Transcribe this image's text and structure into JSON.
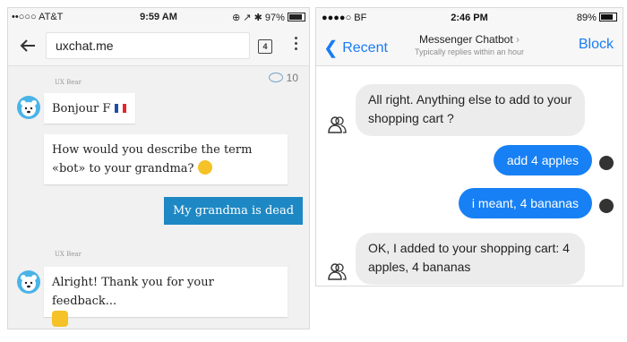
{
  "left_phone": {
    "status": {
      "carrier": "••○○○ AT&T",
      "time": "9:59 AM",
      "battery": "97%"
    },
    "url": "uxchat.me",
    "tab_count": "4",
    "viewer_count": "10",
    "messages": [
      {
        "sender": "UX Bear",
        "text": "Bonjour F"
      },
      {
        "text": "How would you describe the term «bot» to your grandma?"
      },
      {
        "text": "My grandma is dead"
      },
      {
        "sender": "UX Bear",
        "text": "Alright! Thank you for your feedback..."
      }
    ]
  },
  "right_phone": {
    "status": {
      "carrier": "●●●●○ BF",
      "time": "2:46 PM",
      "battery": "89%"
    },
    "nav": {
      "back": "Recent",
      "title": "Messenger Chatbot",
      "subtitle": "Typically replies within an hour",
      "block": "Block"
    },
    "messages": [
      {
        "text": "All right. Anything else to add to your shopping cart ?"
      },
      {
        "text": "add 4 apples"
      },
      {
        "text": "i meant, 4 bananas"
      },
      {
        "text": "OK, I added to your shopping cart: 4 apples, 4 bananas"
      }
    ]
  },
  "colors": {
    "user_bubble_left": "#1e88c4",
    "user_bubble_right": "#1780f4",
    "ios_blue": "#1a7cf5"
  }
}
